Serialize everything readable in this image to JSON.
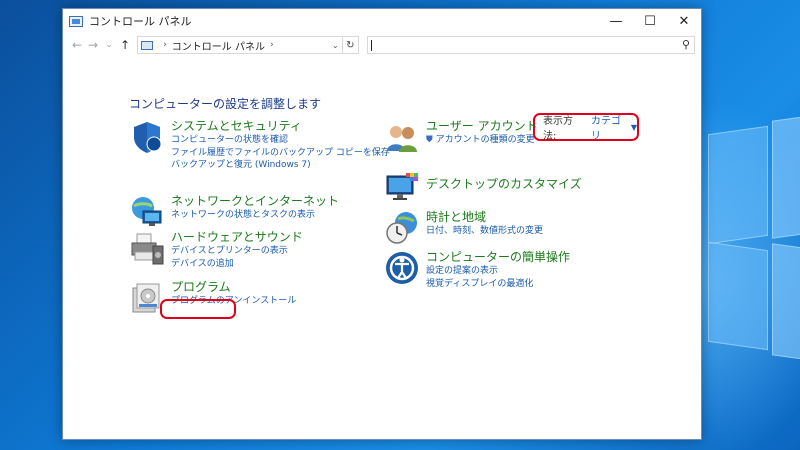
{
  "window": {
    "title": "コントロール パネル",
    "controls": {
      "minimize": "—",
      "maximize": "☐",
      "close": "✕"
    }
  },
  "address": {
    "back": "←",
    "forward": "→",
    "recent": "⌄",
    "up": "↑",
    "path_root": "›",
    "path_label": "コントロール パネル",
    "path_sep": "›",
    "dropdown": "⌄",
    "refresh": "↻",
    "search_placeholder": "",
    "search_icon": "⚲"
  },
  "page": {
    "title": "コンピューターの設定を調整します",
    "view_by_label": "表示方法:",
    "view_by_value": "カテゴリ",
    "view_by_arrow": "▼"
  },
  "categories_left": [
    {
      "title": "システムとセキュリティ",
      "icon": "shield-icon",
      "links": [
        "コンピューターの状態を確認",
        "ファイル履歴でファイルのバックアップ コピーを保存",
        "バックアップと復元 (Windows 7)"
      ]
    },
    {
      "title": "ネットワークとインターネット",
      "icon": "network-icon",
      "links": [
        "ネットワークの状態とタスクの表示"
      ]
    },
    {
      "title": "ハードウェアとサウンド",
      "icon": "printer-icon",
      "links": [
        "デバイスとプリンターの表示",
        "デバイスの追加"
      ]
    },
    {
      "title": "プログラム",
      "icon": "programs-icon",
      "links": [
        "プログラムのアンインストール"
      ]
    }
  ],
  "categories_right": [
    {
      "title": "ユーザー アカウント",
      "icon": "users-icon",
      "links": [
        "アカウントの種類の変更"
      ]
    },
    {
      "title": "デスクトップのカスタマイズ",
      "icon": "display-icon",
      "links": []
    },
    {
      "title": "時計と地域",
      "icon": "clock-globe-icon",
      "links": [
        "日付、時刻、数値形式の変更"
      ]
    },
    {
      "title": "コンピューターの簡単操作",
      "icon": "ease-of-access-icon",
      "links": [
        "設定の提案の表示",
        "視覚ディスプレイの最適化"
      ]
    }
  ],
  "colors": {
    "accent_link": "#1a5bb0",
    "category_title": "#1c7a1c",
    "highlight": "#e0001b",
    "desktop": "#0e7ad6"
  }
}
